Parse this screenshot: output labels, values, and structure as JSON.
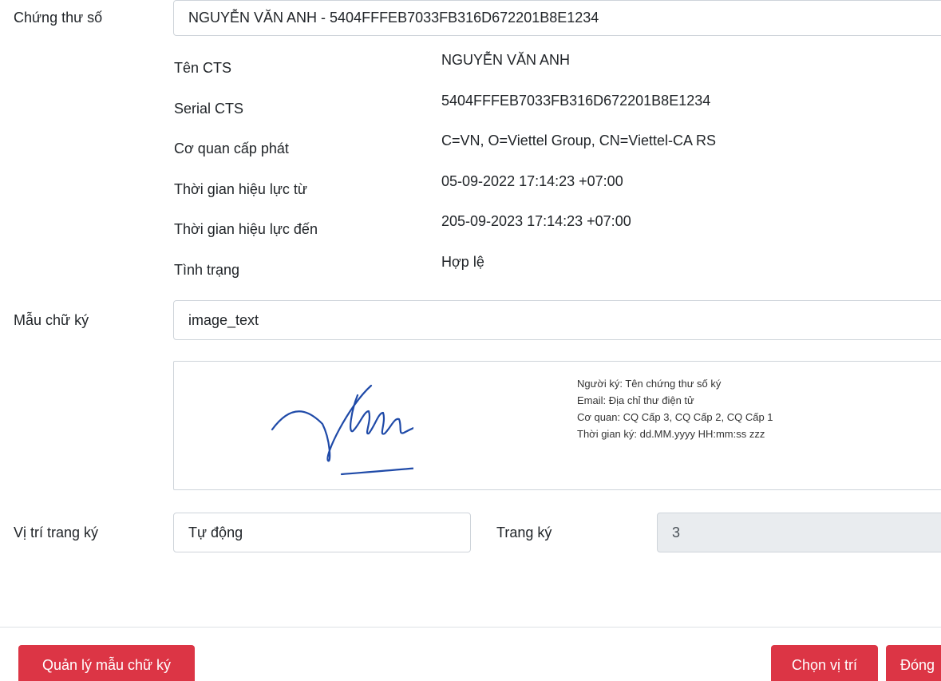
{
  "form": {
    "certificate_label": "Chứng thư số",
    "certificate_value": "NGUYỄN VĂN ANH - 5404FFFEB7033FB316D672201B8E1234",
    "certificate_info": [
      {
        "label": "Tên CTS",
        "value": "NGUYỄN VĂN ANH"
      },
      {
        "label": "Serial CTS",
        "value": "5404FFFEB7033FB316D672201B8E1234"
      },
      {
        "label": "Cơ quan cấp phát",
        "value": "C=VN, O=Viettel Group, CN=Viettel-CA RS"
      },
      {
        "label": "Thời gian hiệu lực từ",
        "value": "05-09-2022 17:14:23 +07:00"
      },
      {
        "label": "Thời gian hiệu lực đến",
        "value": "205-09-2023 17:14:23 +07:00"
      },
      {
        "label": "Tình trạng",
        "value": "Hợp lệ"
      }
    ],
    "template_label": "Mẫu chữ ký",
    "template_value": "image_text",
    "preview_lines": [
      "Người ký: Tên chứng thư số ký",
      "Email: Địa chỉ thư điện tử",
      "Cơ quan: CQ Cấp 3, CQ Cấp 2, CQ Cấp 1",
      "Thời gian ký: dd.MM.yyyy HH:mm:ss zzz"
    ],
    "position_label": "Vị trí trang ký",
    "position_value": "Tự động",
    "page_label": "Trang ký",
    "page_value": "3"
  },
  "footer": {
    "manage_templates_button": "Quản lý mẫu chữ ký",
    "choose_position_button": "Chọn vị trí",
    "close_button": "Đóng"
  },
  "colors": {
    "button_red": "#dc3545",
    "signature_ink": "#1f4aa8"
  },
  "icons": {
    "signature": "handwritten-signature-image"
  }
}
